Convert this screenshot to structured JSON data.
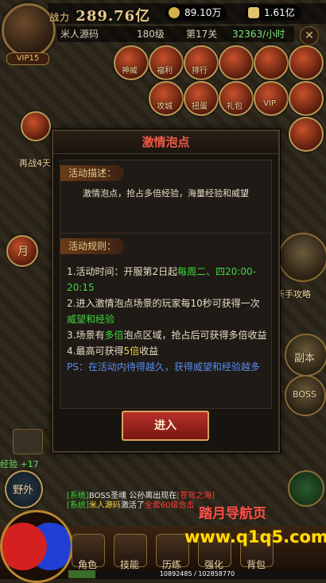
{
  "header": {
    "power_label": "战力",
    "power_value": "289.76亿",
    "gold": "89.10万",
    "ingot": "1.61亿",
    "player_name": "米人源码",
    "level": "180级",
    "rank_text": "第17关",
    "rate_text": "32363/小时",
    "vip": "VIP15"
  },
  "activities": [
    "神威",
    "福利",
    "排行",
    "",
    "",
    "",
    "",
    "攻城",
    "扭蛋",
    "",
    "礼包",
    "VIP",
    "",
    "再战4天",
    "",
    "月"
  ],
  "left": {
    "battle_days": "再战4天",
    "month_label": "月",
    "exp_gain": "经验 +17",
    "field_label": "野外"
  },
  "dialog": {
    "title": "激情泡点",
    "desc_tag": "活动描述：",
    "desc_text": "激情泡点，抢占多倍经验，海量经验和威望",
    "rules_tag": "活动规则：",
    "rule1_a": "1.活动时间：开服第2日起",
    "rule1_b": "每周二、四20:00-20:15",
    "rule2_a": "2.进入激情泡点场景的玩家每10秒可获得一次",
    "rule2_b": "威望和经验",
    "rule3_a": "3.场景有",
    "rule3_b": "多倍",
    "rule3_c": "泡点区域，抢占后可获得多倍收益",
    "rule4_a": "4.最高可获得",
    "rule4_b": "5倍",
    "rule4_c": "收益",
    "ps": "PS：在活动内待得越久，获得威望和经验越多",
    "enter": "进入"
  },
  "right": {
    "guide": "新手攻略",
    "copy": "副本",
    "boss": "BOSS"
  },
  "chat": {
    "line1_sys": "[系统]",
    "line1_a": "BOSS圣魂 公孙离出现在",
    "line1_place": "[苍穹之海]",
    "line2_sys": "[系统]",
    "line2_name": "米人源码",
    "line2_a": "激活了",
    "line2_b": "全套60级合击"
  },
  "bottom": {
    "skills": [
      "角色",
      "技能",
      "历练",
      "强化",
      "背包"
    ],
    "xp_text": "10892485 / 102858770",
    "xp_fraction": 0.106
  },
  "brand": {
    "name": "踏月导航页",
    "url": "www.q1q5.com"
  }
}
